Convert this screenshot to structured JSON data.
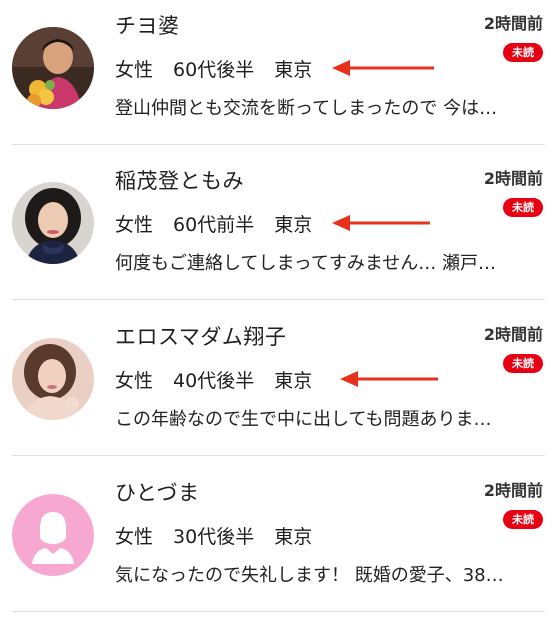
{
  "colors": {
    "unread_badge": "#e60012",
    "annotation_arrow": "#e5321c",
    "divider": "#dedede",
    "placeholder_avatar": "#f7a8d0"
  },
  "messages": [
    {
      "name": "チヨ婆",
      "gender": "女性",
      "age": "60代後半",
      "location": "東京",
      "preview": "登山仲間とも交流を断ってしまったので 今は…",
      "time": "2時間前",
      "badge": "未読",
      "avatar": "photo"
    },
    {
      "name": "稲茂登ともみ",
      "gender": "女性",
      "age": "60代前半",
      "location": "東京",
      "preview": "何度もご連絡してしまってすみません… 瀬戸…",
      "time": "2時間前",
      "badge": "未読",
      "avatar": "photo"
    },
    {
      "name": "エロスマダム翔子",
      "gender": "女性",
      "age": "40代後半",
      "location": "東京",
      "preview": "この年齢なので生で中に出しても問題ありま…",
      "time": "2時間前",
      "badge": "未読",
      "avatar": "photo"
    },
    {
      "name": "ひとづま",
      "gender": "女性",
      "age": "30代後半",
      "location": "東京",
      "preview": "気になったので失礼します！ 既婚の愛子、38…",
      "time": "2時間前",
      "badge": "未読",
      "avatar": "default-user-icon"
    }
  ]
}
